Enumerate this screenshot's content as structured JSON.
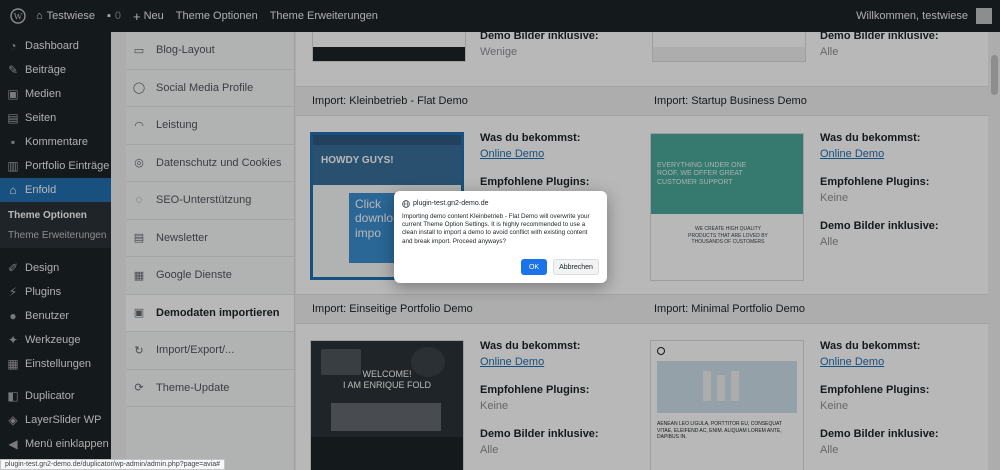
{
  "adminbar": {
    "site_name": "Testwiese",
    "comments_count": "0",
    "new_label": "Neu",
    "theme_options": "Theme Optionen",
    "theme_extensions": "Theme Erweiterungen",
    "welcome": "Willkommen, testwiese"
  },
  "sidebar": {
    "items": [
      {
        "label": "Dashboard",
        "icon": "dashboard-icon"
      },
      {
        "label": "Beiträge",
        "icon": "pin-icon"
      },
      {
        "label": "Medien",
        "icon": "media-icon"
      },
      {
        "label": "Seiten",
        "icon": "pages-icon"
      },
      {
        "label": "Kommentare",
        "icon": "comment-icon"
      },
      {
        "label": "Portfolio Einträge",
        "icon": "portfolio-icon"
      },
      {
        "label": "Enfold",
        "icon": "home-icon"
      }
    ],
    "submenu": [
      "Theme Optionen",
      "Theme Erweiterungen"
    ],
    "items2": [
      {
        "label": "Design",
        "icon": "brush-icon"
      },
      {
        "label": "Plugins",
        "icon": "plug-icon"
      },
      {
        "label": "Benutzer",
        "icon": "user-icon"
      },
      {
        "label": "Werkzeuge",
        "icon": "wrench-icon"
      },
      {
        "label": "Einstellungen",
        "icon": "settings-icon"
      }
    ],
    "items3": [
      {
        "label": "Duplicator",
        "icon": "duplicator-icon"
      },
      {
        "label": "LayerSlider WP",
        "icon": "layers-icon"
      },
      {
        "label": "Menü einklappen",
        "icon": "collapse-icon"
      }
    ]
  },
  "theme_nav": [
    {
      "label": "Blog-Layout",
      "icon": "blog-icon"
    },
    {
      "label": "Social Media Profile",
      "icon": "social-icon"
    },
    {
      "label": "Leistung",
      "icon": "performance-icon"
    },
    {
      "label": "Datenschutz und Cookies",
      "icon": "privacy-icon"
    },
    {
      "label": "SEO-Unterstützung",
      "icon": "seo-icon"
    },
    {
      "label": "Newsletter",
      "icon": "newsletter-icon"
    },
    {
      "label": "Google Dienste",
      "icon": "google-icon"
    },
    {
      "label": "Demodaten importieren",
      "icon": "import-demo-icon"
    },
    {
      "label": "Import/Export/...",
      "icon": "import-export-icon"
    },
    {
      "label": "Theme-Update",
      "icon": "update-icon"
    }
  ],
  "labels": {
    "get": "Was du bekommst:",
    "online_demo": "Online Demo",
    "plugins": "Empfohlene Plugins:",
    "images": "Demo Bilder inklusive:"
  },
  "top_row": {
    "left_images_label": "Demo Bilder inklusive:",
    "left_images_value": "Wenige",
    "right_images_label": "Demo Bilder inklusive:",
    "right_images_value": "Alle"
  },
  "demos": [
    {
      "title": "Import: Kleinbetrieb - Flat Demo",
      "plugins_value": "",
      "images_value": "",
      "thumb_texts": [
        "HOWDY GUYS!",
        "Click",
        "downlo",
        "impo"
      ]
    },
    {
      "title": "Import: Startup Business Demo",
      "plugins_value": "Keine",
      "images_value": "Alle",
      "thumb_texts": [
        "EVERYTHING UNDER ONE",
        "ROOF. WE OFFER GREAT",
        "CUSTOMER SUPPORT",
        "WE CREATE HIGH QUALITY",
        "PRODUCTS THAT ARE LOVED BY",
        "THOUSANDS OF CUSTOMERS"
      ]
    },
    {
      "title": "Import: Einseitige Portfolio Demo",
      "plugins_value": "Keine",
      "images_value": "Alle",
      "thumb_texts": [
        "WELCOME!",
        "I AM ENRIQUE FOLD"
      ]
    },
    {
      "title": "Import: Minimal Portfolio Demo",
      "plugins_value": "Keine",
      "images_value": "Alle",
      "thumb_texts": [
        "AENEAN LEO LIGULA, PORTTITOR EU, CONSEQUAT",
        "VITAE, ELEIFEND AC, ENIM. ALIQUAM LOREM ANTE, DAPIBUS IN."
      ]
    }
  ],
  "modal": {
    "host": "plugin-test.gn2-demo.de",
    "message": "Importing demo content Kleinbetrieb - Flat Demo will overwrite your current Theme Option Settings. It is highly recommended to use a clean install to import a demo to avoid conflict with existing content and break import. Proceed anyways?",
    "ok": "OK",
    "cancel": "Abbrechen"
  },
  "statusbar": "plugin-test.gn2-demo.de/duplicator/wp-admin/admin.php?page=avia#"
}
